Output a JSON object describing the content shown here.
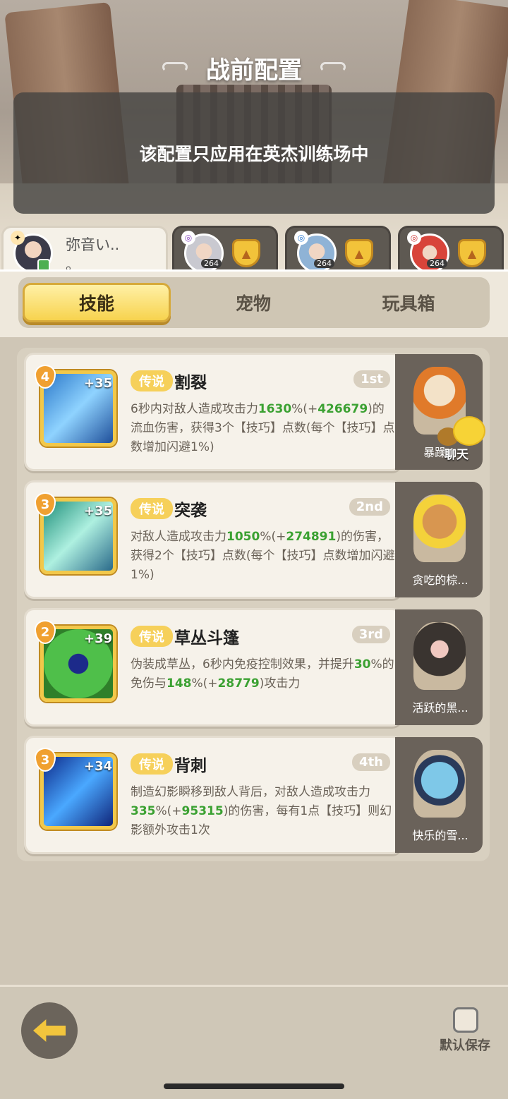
{
  "header": {
    "title": "战前配置",
    "notice": "该配置只应用在英杰训练场中"
  },
  "heroes": [
    {
      "name": "弥音い..",
      "sub": "。",
      "level": null,
      "active": true
    },
    {
      "name": "",
      "level": "264",
      "active": false
    },
    {
      "name": "",
      "level": "264",
      "active": false
    },
    {
      "name": "",
      "level": "264",
      "active": false
    }
  ],
  "categories": [
    "技能",
    "宠物",
    "玩具箱"
  ],
  "skills": [
    {
      "icon": "tear-skill-icon",
      "level": "4",
      "bonus": "+35",
      "rarity": "传说",
      "name": "割裂",
      "rank": "1st",
      "desc_parts": [
        "6秒内对敌人造成攻击力",
        "1630",
        "%(+",
        "426679",
        ")的流血伤害，获得3个【技巧】点数(每个【技巧】点数增加闪避1%)"
      ]
    },
    {
      "icon": "assault-skill-icon",
      "level": "3",
      "bonus": "+35",
      "rarity": "传说",
      "name": "突袭",
      "rank": "2nd",
      "desc_parts": [
        "对敌人造成攻击力",
        "1050",
        "%(+",
        "274891",
        ")的伤害，获得2个【技巧】点数(每个【技巧】点数增加闪避1%)"
      ]
    },
    {
      "icon": "bush-cloak-skill-icon",
      "level": "2",
      "bonus": "+39",
      "rarity": "传说",
      "name": "草丛斗篷",
      "rank": "3rd",
      "desc_parts": [
        "伪装成草丛，6秒内免疫控制效果，并提升",
        "30",
        "%的免伤与",
        "148",
        "%(+",
        "28779",
        ")攻击力"
      ]
    },
    {
      "icon": "backstab-skill-icon",
      "level": "3",
      "bonus": "+34",
      "rarity": "传说",
      "name": "背刺",
      "rank": "4th",
      "desc_parts": [
        "制造幻影瞬移到敌人背后，对敌人造成攻击力",
        "335",
        "%(+",
        "95315",
        ")的伤害，每有1点【技巧】则幻影额外攻击1次"
      ]
    }
  ],
  "pets": [
    {
      "name": "暴躁..."
    },
    {
      "name": "贪吃的棕..."
    },
    {
      "name": "活跃的黑..."
    },
    {
      "name": "快乐的雪..."
    }
  ],
  "chat": {
    "label": "聊天"
  },
  "footer": {
    "default_save_label": "默认保存"
  },
  "colors": {
    "accent_gold": "#f7d34e",
    "highlight_green": "#3ba132"
  }
}
